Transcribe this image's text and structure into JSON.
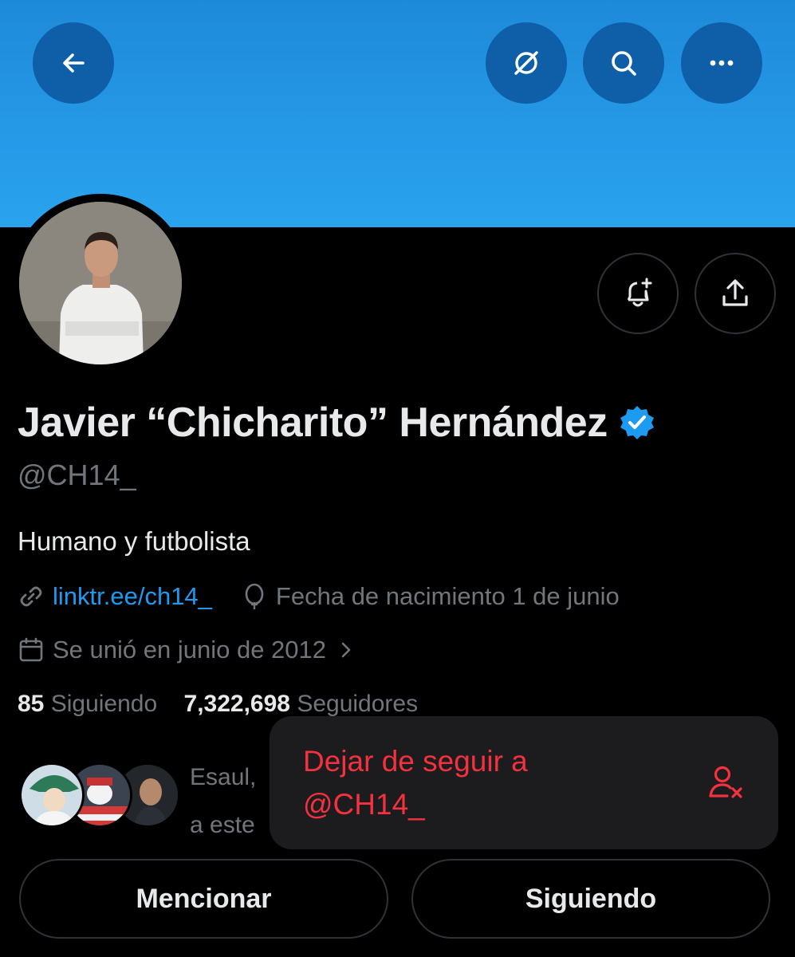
{
  "header": {
    "back_icon": "arrow-left-icon",
    "translate_icon": "grok-icon",
    "search_icon": "search-icon",
    "more_icon": "more-icon"
  },
  "profile": {
    "name": "Javier “Chicharito” Hernández",
    "handle": "@CH14_",
    "bio": "Humano y futbolista",
    "link": "linktr.ee/ch14_",
    "birthday": "Fecha de nacimiento 1 de junio",
    "joined": "Se unió en junio de 2012",
    "following_count": "85",
    "following_label": "Siguiendo",
    "followers_count": "7,322,698",
    "followers_label": "Seguidores",
    "followed_by_line1": "Esaul,",
    "followed_by_line2": "a este"
  },
  "menu": {
    "unfollow_label": "Dejar de seguir a @CH14_"
  },
  "actions": {
    "mention": "Mencionar",
    "following": "Siguiendo"
  },
  "colors": {
    "banner": "#2598e6",
    "link": "#1d9bf0",
    "danger": "#f4313e",
    "muted": "#71767b"
  }
}
